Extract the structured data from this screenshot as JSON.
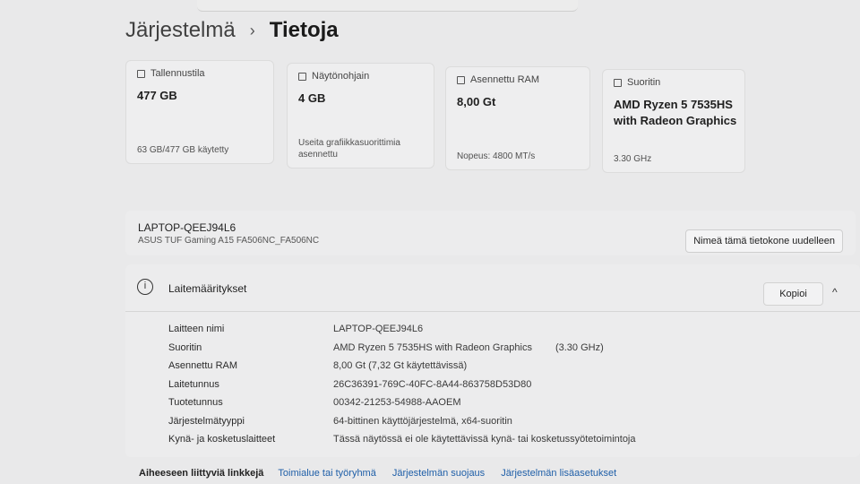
{
  "breadcrumb": {
    "root": "Järjestelmä",
    "separator": "›",
    "current": "Tietoja"
  },
  "cards": [
    {
      "label": "Tallennustila",
      "icon": "storage-icon",
      "value": "477 GB",
      "foot": "63 GB/477 GB käytetty"
    },
    {
      "label": "Näytönohjain",
      "icon": "display-adapter-icon",
      "value": "4 GB",
      "foot": "Useita grafiikkasuorittimia asennettu"
    },
    {
      "label": "Asennettu RAM",
      "icon": "ram-icon",
      "value": "8,00 Gt",
      "foot": "Nopeus: 4800 MT/s"
    },
    {
      "label": "Suoritin",
      "icon": "processor-icon",
      "value": "AMD Ryzen 5 7535HS with Radeon Graphics",
      "foot": "3.30 GHz"
    }
  ],
  "device": {
    "name": "LAPTOP-QEEJ94L6",
    "model": "ASUS TUF Gaming A15 FA506NC_FA506NC",
    "rename_label": "Nimeä tämä tietokone uudelleen"
  },
  "specs": {
    "title": "Laitemääritykset",
    "copy_label": "Kopioi",
    "chevron": "^",
    "rows": [
      {
        "key": "Laitteen nimi",
        "value": "LAPTOP-QEEJ94L6",
        "sub": ""
      },
      {
        "key": "Suoritin",
        "value": "AMD Ryzen 5 7535HS with Radeon Graphics",
        "sub": "(3.30 GHz)"
      },
      {
        "key": "Asennettu RAM",
        "value": "8,00 Gt (7,32 Gt käytettävissä)",
        "sub": ""
      },
      {
        "key": "Laitetunnus",
        "value": "26C36391-769C-40FC-8A44-863758D53D80",
        "sub": ""
      },
      {
        "key": "Tuotetunnus",
        "value": "00342-21253-54988-AAOEM",
        "sub": ""
      },
      {
        "key": "Järjestelmätyyppi",
        "value": "64-bittinen käyttöjärjestelmä, x64-suoritin",
        "sub": ""
      },
      {
        "key": "Kynä- ja kosketuslaitteet",
        "value": "Tässä näytössä ei ole käytettävissä kynä- tai kosketussyötetoimintoja",
        "sub": ""
      }
    ]
  },
  "related": {
    "label": "Aiheeseen liittyviä linkkejä",
    "links": [
      "Toimialue tai työryhmä",
      "Järjestelmän suojaus",
      "Järjestelmän lisäasetukset"
    ]
  }
}
